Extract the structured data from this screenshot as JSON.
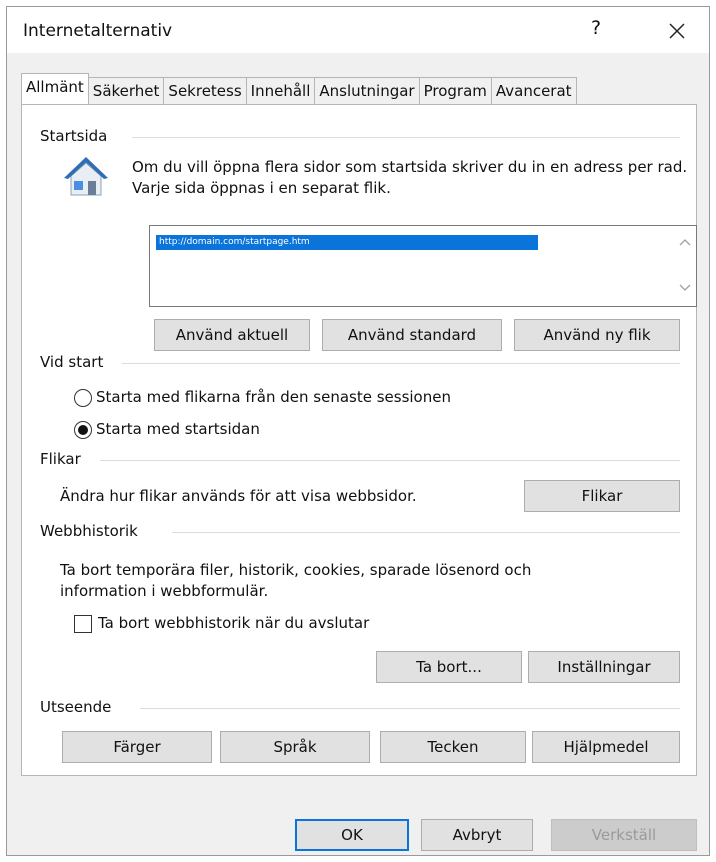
{
  "window": {
    "title": "Internetalternativ",
    "help_label": "?"
  },
  "tabs": [
    {
      "label": "Allmänt",
      "active": true
    },
    {
      "label": "Säkerhet"
    },
    {
      "label": "Sekretess"
    },
    {
      "label": "Innehåll"
    },
    {
      "label": "Anslutningar"
    },
    {
      "label": "Program"
    },
    {
      "label": "Avancerat"
    }
  ],
  "startsida": {
    "heading": "Startsida",
    "description": "Om du vill öppna flera sidor som startsida skriver du in en adress per rad. Varje sida öppnas i en separat flik.",
    "urls": [
      "http://domain.com/startpage.htm"
    ],
    "buttons": {
      "current": "Använd aktuell",
      "default": "Använd standard",
      "new_tab": "Använd ny flik"
    }
  },
  "vid_start": {
    "heading": "Vid start",
    "options": [
      {
        "label": "Starta med flikarna från den senaste sessionen",
        "selected": false
      },
      {
        "label": "Starta med startsidan",
        "selected": true
      }
    ]
  },
  "flikar": {
    "heading": "Flikar",
    "description": "Ändra hur flikar används för att visa webbsidor.",
    "button": "Flikar"
  },
  "webbhistorik": {
    "heading": "Webbhistorik",
    "description": "Ta bort temporära filer, historik, cookies, sparade lösenord och information i webbformulär.",
    "checkbox_label": "Ta bort webbhistorik när du avslutar",
    "checkbox_checked": false,
    "delete_button": "Ta bort...",
    "settings_button": "Inställningar"
  },
  "utseende": {
    "heading": "Utseende",
    "buttons": {
      "colors": "Färger",
      "languages": "Språk",
      "fonts": "Tecken",
      "accessibility": "Hjälpmedel"
    }
  },
  "footer": {
    "ok": "OK",
    "cancel": "Avbryt",
    "apply": "Verkställ"
  },
  "colors": {
    "accent": "#0a74da",
    "button_face": "#e1e1e1",
    "dialog_bg": "#f0f0f0"
  }
}
